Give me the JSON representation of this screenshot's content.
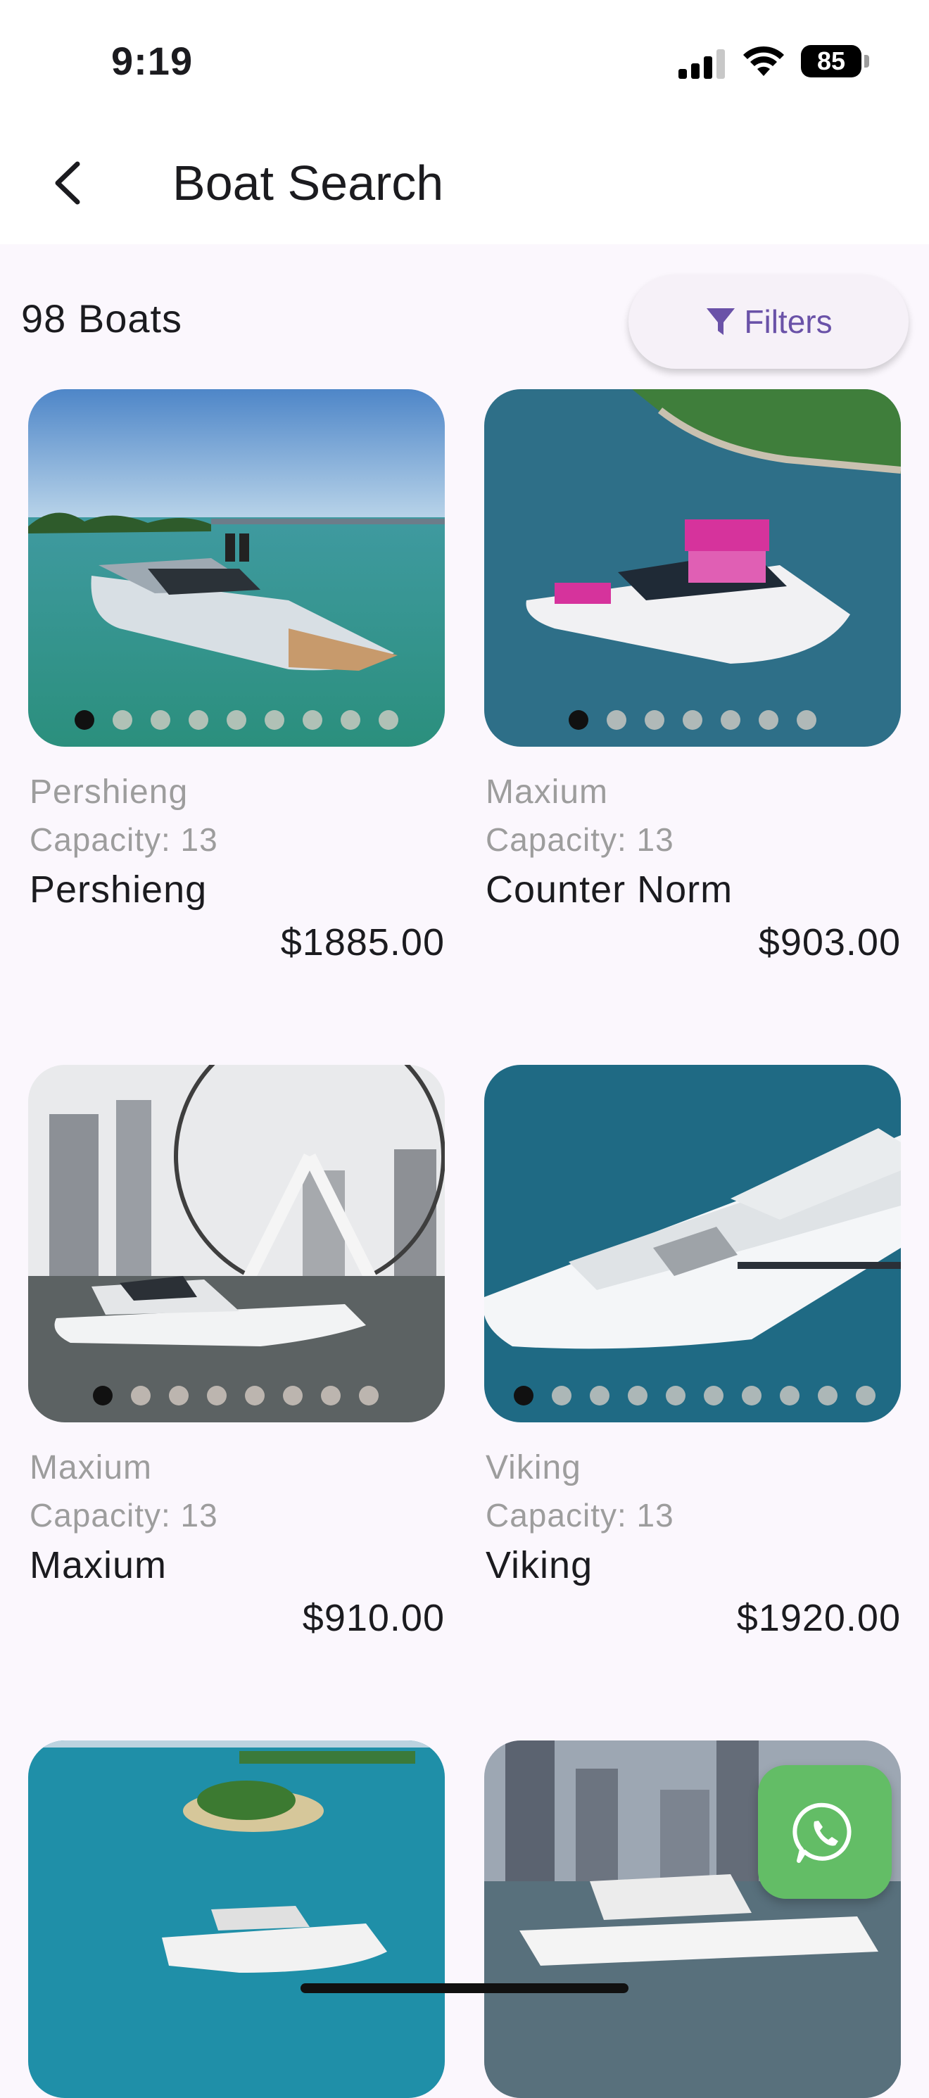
{
  "status": {
    "time": "9:19",
    "battery": "85"
  },
  "header": {
    "title": "Boat Search"
  },
  "results": {
    "count_label": "98 Boats",
    "filter_label": "Filters"
  },
  "boats": [
    {
      "make": "Pershieng",
      "capacity": "Capacity: 13",
      "name": "Pershieng",
      "price": "$1885.00",
      "dots": 9
    },
    {
      "make": "Maxium",
      "capacity": "Capacity: 13",
      "name": "Counter Norm",
      "price": "$903.00",
      "dots": 7
    },
    {
      "make": "Maxium",
      "capacity": "Capacity: 13",
      "name": "Maxium",
      "price": "$910.00",
      "dots": 8
    },
    {
      "make": "Viking",
      "capacity": "Capacity: 13",
      "name": "Viking",
      "price": "$1920.00",
      "dots": 10
    }
  ],
  "colors": {
    "accent": "#6a52a8",
    "fab": "#63bd66",
    "background": "#fbf7fd"
  },
  "icons": {
    "back": "back-arrow-icon",
    "filter": "filter-icon",
    "fab": "whatsapp-icon"
  }
}
